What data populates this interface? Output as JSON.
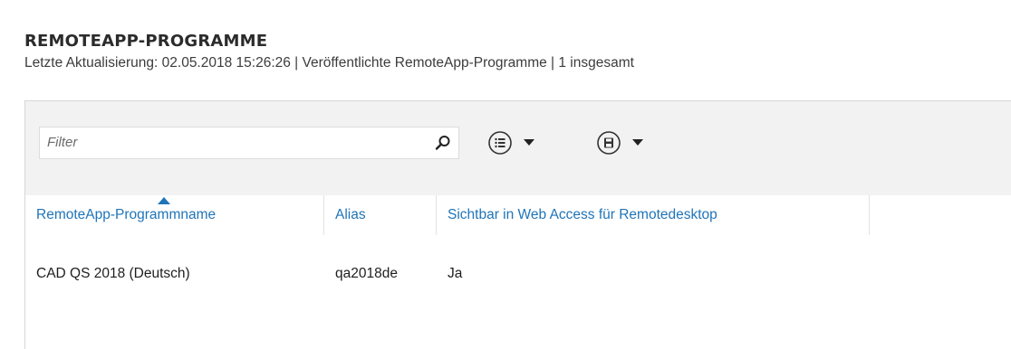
{
  "header": {
    "title": "REMOTEAPP-PROGRAMME",
    "subtitle": "Letzte Aktualisierung: 02.05.2018 15:26:26 | Veröffentlichte RemoteApp-Programme  | 1 insgesamt"
  },
  "toolbar": {
    "filter_placeholder": "Filter",
    "search_icon": "search-icon",
    "view_options_icon": "list-icon",
    "save_icon": "save-icon",
    "dropdown_icon": "caret-down-icon"
  },
  "table": {
    "columns": [
      "RemoteApp-Programmname",
      "Alias",
      "Sichtbar in Web Access für Remotedesktop"
    ],
    "sorted_column": "RemoteApp-Programmname",
    "sort_direction": "ascending",
    "rows": [
      [
        "CAD QS 2018 (Deutsch)",
        "qa2018de",
        "Ja"
      ]
    ]
  },
  "colors": {
    "accent": "#1f74b8",
    "toolbar_bg": "#f2f2f2",
    "text": "#1e1e1e"
  }
}
